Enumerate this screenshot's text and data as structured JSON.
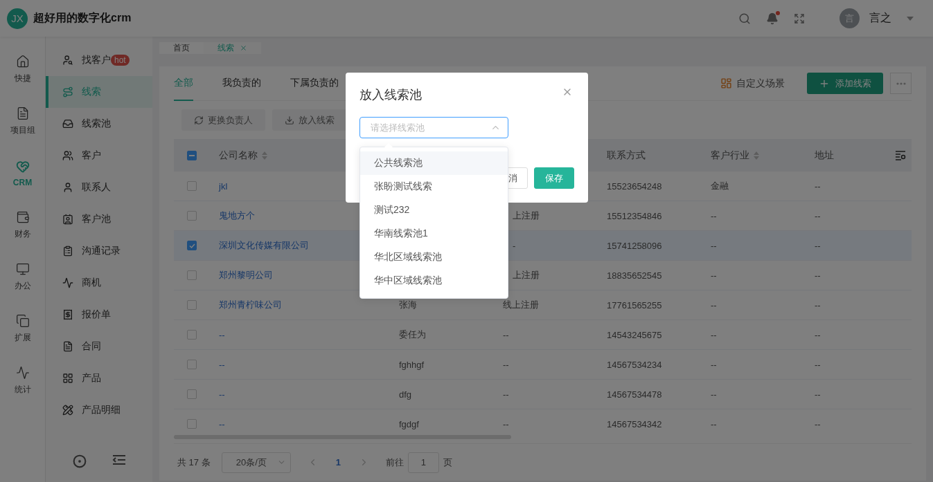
{
  "header": {
    "logo": "JX",
    "title": "超好用的数字化crm",
    "unread": true,
    "user": {
      "avatar": "言",
      "name": "言之"
    }
  },
  "rail": [
    {
      "label": "快捷",
      "selected": false
    },
    {
      "label": "项目组",
      "selected": false
    },
    {
      "label": "CRM",
      "selected": true
    },
    {
      "label": "财务",
      "selected": false
    },
    {
      "label": "办公",
      "selected": false
    },
    {
      "label": "扩展",
      "selected": false
    },
    {
      "label": "统计",
      "selected": false
    }
  ],
  "sidebar": {
    "items": [
      {
        "label": "找客户",
        "badge": "hot",
        "selected": false
      },
      {
        "label": "线索",
        "selected": true
      },
      {
        "label": "线索池",
        "selected": false
      },
      {
        "label": "客户",
        "selected": false
      },
      {
        "label": "联系人",
        "selected": false
      },
      {
        "label": "客户池",
        "selected": false
      },
      {
        "label": "沟通记录",
        "selected": false
      },
      {
        "label": "商机",
        "selected": false
      },
      {
        "label": "报价单",
        "selected": false
      },
      {
        "label": "合同",
        "selected": false
      },
      {
        "label": "产品",
        "selected": false
      },
      {
        "label": "产品明细",
        "selected": false
      }
    ]
  },
  "page_tabs": [
    {
      "label": "首页",
      "selected": false,
      "closable": false
    },
    {
      "label": "线索",
      "selected": true,
      "closable": true
    }
  ],
  "view_tabs": [
    {
      "label": "全部",
      "selected": true
    },
    {
      "label": "我负责的",
      "selected": false
    },
    {
      "label": "下属负责的",
      "selected": false
    }
  ],
  "scene_button": "自定义场景",
  "add_button": "添加线索",
  "toolbar": [
    "更换负责人",
    "放入线索"
  ],
  "table": {
    "header_checkbox": {
      "indeterminate": true
    },
    "columns": [
      {
        "label": "公司名称",
        "sortable": true,
        "kind": "link"
      },
      {
        "kind": "text"
      },
      {
        "kind": "text"
      },
      {
        "label": "联系方式",
        "sortable": false,
        "kind": "text"
      },
      {
        "label": "客户行业",
        "sortable": true,
        "kind": "text"
      },
      {
        "label": "地址",
        "sortable": false,
        "kind": "text"
      }
    ],
    "rows": [
      {
        "checked": false,
        "cells": [
          "jkl",
          null,
          null,
          "15523654248",
          "金融",
          "--"
        ]
      },
      {
        "checked": false,
        "cells": [
          "鬼地方个",
          null,
          {
            "text": "上注册",
            "clipped": true
          },
          "15512354846",
          "--",
          "--"
        ]
      },
      {
        "checked": true,
        "cells": [
          "深圳文化传媒有限公司",
          null,
          {
            "text": "-",
            "clipped": true
          },
          "15741258096",
          "--",
          "--"
        ]
      },
      {
        "checked": false,
        "cells": [
          "郑州黎明公司",
          null,
          {
            "text": "上注册",
            "clipped": true
          },
          "18835652545",
          "--",
          "--"
        ]
      },
      {
        "checked": false,
        "cells": [
          "郑州青柠味公司",
          "张海",
          "线上注册",
          "17761565255",
          "--",
          "--"
        ]
      },
      {
        "checked": false,
        "cells": [
          "--",
          "委任为",
          "--",
          "14543245675",
          "--",
          "--"
        ]
      },
      {
        "checked": false,
        "cells": [
          "--",
          "fghhgf",
          "--",
          "14567534234",
          "--",
          "--"
        ]
      },
      {
        "checked": false,
        "cells": [
          "--",
          "dfg",
          "--",
          "14567534478",
          "--",
          "--"
        ]
      },
      {
        "checked": false,
        "cells": [
          "--",
          "fgdgf",
          "--",
          "14567534342",
          "--",
          "--"
        ]
      }
    ]
  },
  "pagination": {
    "total": "共 17 条",
    "page_size": "20条/页",
    "pages": [
      {
        "label": "1",
        "selected": true
      }
    ],
    "goto_label": "前往",
    "goto_value": "1",
    "page_unit": "页"
  },
  "modal": {
    "title": "放入线索池",
    "select": {
      "placeholder": "请选择线索池",
      "open": true,
      "options": [
        {
          "label": "公共线索池",
          "highlighted": true
        },
        {
          "label": "张盼测试线索",
          "highlighted": false
        },
        {
          "label": "测试232",
          "highlighted": false
        },
        {
          "label": "华南线索池1",
          "highlighted": false
        },
        {
          "label": "华北区域线索池",
          "highlighted": false
        },
        {
          "label": "华中区域线索池",
          "highlighted": false
        }
      ]
    },
    "buttons": [
      {
        "label": "消",
        "kind": "cancel"
      },
      {
        "label": "保存",
        "kind": "primary"
      }
    ]
  }
}
